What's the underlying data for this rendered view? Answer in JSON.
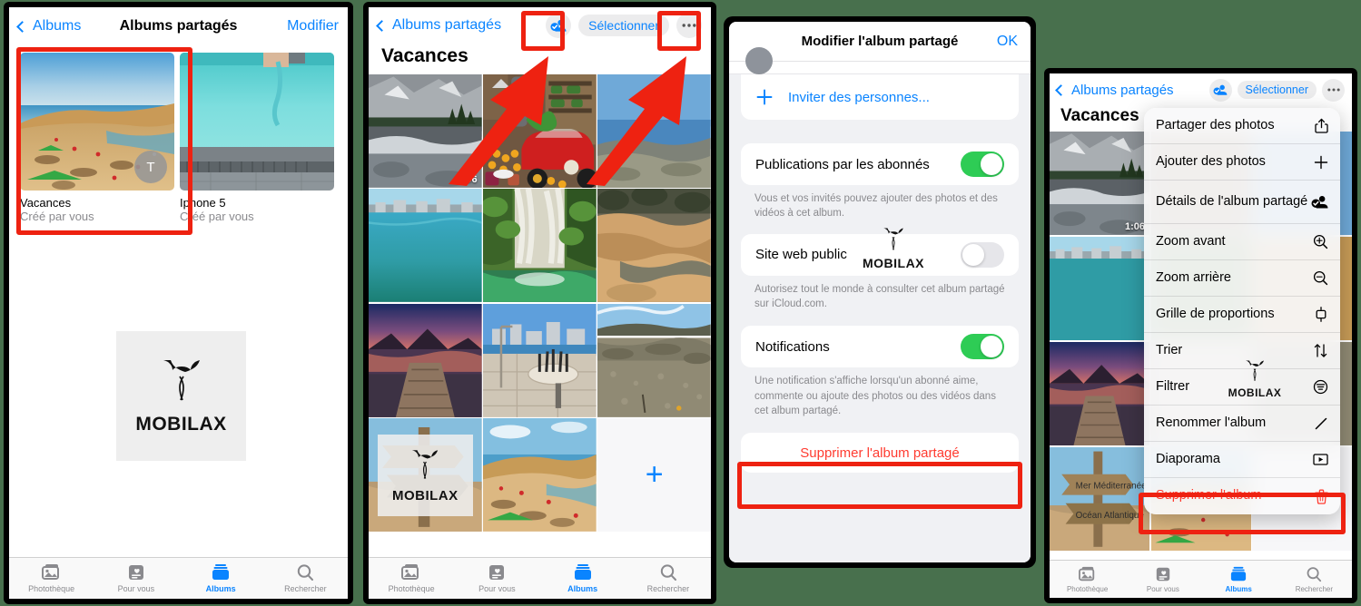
{
  "background_color": "#48704d",
  "accent_blue": "#0a84ff",
  "danger_red": "#ff3b30",
  "highlight_red": "#ee2211",
  "switch_green": "#2ecc55",
  "watermark": {
    "text": "MOBILAX"
  },
  "panel1": {
    "nav": {
      "back": "Albums",
      "title": "Albums partagés",
      "right": "Modifier"
    },
    "albums": [
      {
        "name": "Vacances",
        "subtitle": "Créé par vous",
        "avatar_initial": "T",
        "highlighted": true
      },
      {
        "name": "Iphone 5",
        "subtitle": "Créé par vous",
        "avatar_initial": "",
        "highlighted": false
      }
    ],
    "tabbar": [
      {
        "label": "Photothèque",
        "icon": "photos-icon",
        "active": false
      },
      {
        "label": "Pour vous",
        "icon": "for-you-icon",
        "active": false
      },
      {
        "label": "Albums",
        "icon": "albums-icon",
        "active": true
      },
      {
        "label": "Rechercher",
        "icon": "search-icon",
        "active": false
      }
    ]
  },
  "panel2": {
    "nav": {
      "back": "Albums partagés",
      "shared_album_icon": "shared-album-people-icon",
      "select": "Sélectionner",
      "more": "more-ellipsis-icon"
    },
    "title": "Vacances",
    "video_duration": "1:06",
    "add_button": "+",
    "tabbar": [
      {
        "label": "Photothèque",
        "icon": "photos-icon",
        "active": false
      },
      {
        "label": "Pour vous",
        "icon": "for-you-icon",
        "active": false
      },
      {
        "label": "Albums",
        "icon": "albums-icon",
        "active": true
      },
      {
        "label": "Rechercher",
        "icon": "search-icon",
        "active": false
      }
    ]
  },
  "panel3": {
    "header": {
      "title": "Modifier l'album partagé",
      "ok": "OK"
    },
    "invite": {
      "label": "Inviter des personnes...",
      "icon": "plus-icon"
    },
    "settings": [
      {
        "label": "Publications par les abonnés",
        "state": "on",
        "footnote": "Vous et vos invités pouvez ajouter des photos et des vidéos à cet album."
      },
      {
        "label": "Site web public",
        "state": "off",
        "footnote": "Autorisez tout le monde à consulter cet album partagé sur iCloud.com."
      },
      {
        "label": "Notifications",
        "state": "on",
        "footnote": "Une notification s'affiche lorsqu'un abonné aime, commente ou ajoute des photos ou des vidéos dans cet album partagé."
      }
    ],
    "delete_button": "Supprimer l'album partagé"
  },
  "panel4": {
    "nav": {
      "back": "Albums partagés",
      "shared_album_icon": "shared-album-people-icon",
      "select": "Sélectionner",
      "more": "more-ellipsis-icon"
    },
    "title": "Vacances",
    "video_duration": "1:06",
    "menu": [
      {
        "label": "Partager des photos",
        "icon": "share-icon",
        "destructive": false
      },
      {
        "label": "Ajouter des photos",
        "icon": "plus-icon",
        "destructive": false
      },
      {
        "label": "Détails de l'album partagé",
        "icon": "shared-album-people-icon",
        "destructive": false
      },
      {
        "label": "Zoom avant",
        "icon": "zoom-in-icon",
        "destructive": false
      },
      {
        "label": "Zoom arrière",
        "icon": "zoom-out-icon",
        "destructive": false
      },
      {
        "label": "Grille de proportions",
        "icon": "aspect-grid-icon",
        "destructive": false
      },
      {
        "label": "Trier",
        "icon": "sort-arrows-icon",
        "destructive": false
      },
      {
        "label": "Filtrer",
        "icon": "filter-icon",
        "destructive": false
      },
      {
        "label": "Renommer l'album",
        "icon": "pencil-icon",
        "destructive": false
      },
      {
        "label": "Diaporama",
        "icon": "slideshow-play-icon",
        "destructive": false
      },
      {
        "label": "Supprimer l'album",
        "icon": "trash-icon",
        "destructive": true
      }
    ],
    "tabbar": [
      {
        "label": "Photothèque",
        "icon": "photos-icon",
        "active": false
      },
      {
        "label": "Pour vous",
        "icon": "for-you-icon",
        "active": false
      },
      {
        "label": "Albums",
        "icon": "albums-icon",
        "active": true
      },
      {
        "label": "Rechercher",
        "icon": "search-icon",
        "active": false
      }
    ]
  }
}
